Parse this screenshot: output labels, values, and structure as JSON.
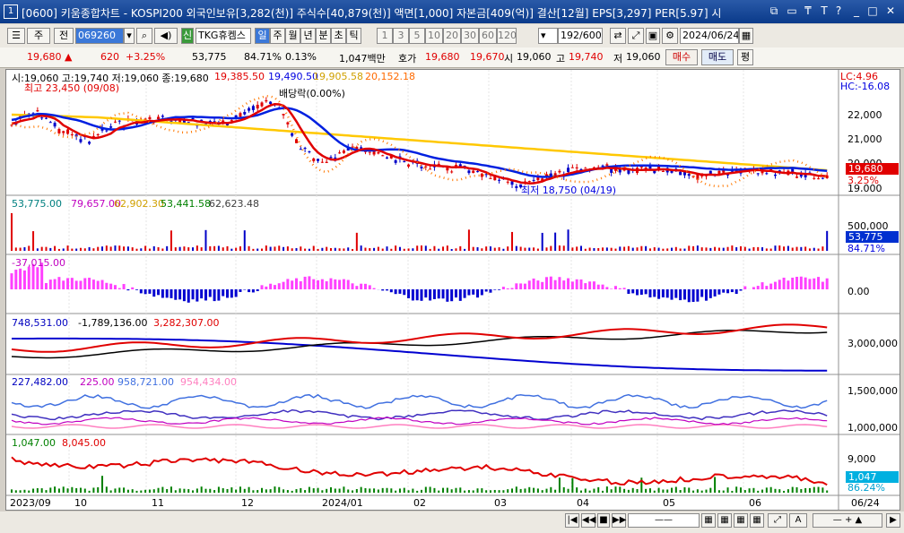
{
  "title": {
    "screen_no": "1",
    "text": "[0600] 키움종합차트 - KOSPI200 외국인보유[3,282(천)] 주식수[40,879(천)] 액면[1,000] 자본금[409(억)] 결산[12월] EPS[3,297] PER[5.97] 시"
  },
  "toolbar": {
    "type_label": "주",
    "period_label": "전",
    "code": "069260",
    "indicator_badge": "신",
    "stock_name": "TKG휴켐스",
    "tabs": [
      "일",
      "주",
      "월",
      "년",
      "분",
      "초",
      "틱"
    ],
    "active_tab": "일",
    "nums": [
      "1",
      "3",
      "5",
      "10",
      "20",
      "30",
      "60",
      "120"
    ],
    "count": "192",
    "total": "/600",
    "date": "2024/06/24"
  },
  "infobar": {
    "price": "19,680",
    "change_arrow": "▲",
    "change": "620",
    "change_pct": "+3.25%",
    "volume": "53,775",
    "vol_ratio": "84.71%",
    "turnover": "0.13%",
    "trade_value": "1,047백만",
    "quote_label": "호가",
    "ask": "19,680",
    "bid": "19,670",
    "open_label": "시",
    "open": "19,060",
    "high_label": "고",
    "high": "19,740",
    "low_label": "저",
    "low": "19,060",
    "buy_label": "매수",
    "sell_label": "매도",
    "avg_label": "평"
  },
  "panel1": {
    "ohlc": "시:19,060 고:19,740 저:19,060 종:19,680",
    "ma1": "19,385.50",
    "ma2": "19,490.50",
    "ma3": "19,905.58",
    "ma4": "20,152.18",
    "high_note": "최고 23,450 (09/08)",
    "low_note": "최저 18,750 (04/19)",
    "dividend_note": "배당락(0.00%)",
    "lc": "LC:4.96",
    "hc": "HC:-16.08",
    "price_box": "19,680",
    "pct_box": "3.25%",
    "y_ticks": [
      "22,000",
      "21,000",
      "20,000",
      "19,000"
    ]
  },
  "panel2": {
    "v1": "53,775.00",
    "v2": "79,657.00",
    "v3": "62,902.30",
    "v4": "53,441.58",
    "v5": "62,623.48",
    "tick": "500,000",
    "box1": "53,775",
    "box2": "84.71%"
  },
  "panel3": {
    "v1": "-37,015.00",
    "tick": "0.00"
  },
  "panel4": {
    "v1": "748,531.00",
    "v2": "-1,789,136.00",
    "v3": "3,282,307.00",
    "tick": "3,000,000"
  },
  "panel5": {
    "v1": "227,482.00",
    "v2": "225.00",
    "v3": "958,721.00",
    "v4": "954,434.00",
    "tick1": "1,500,000",
    "tick2": "1,000,000"
  },
  "panel6": {
    "v1": "1,047.00",
    "v2": "8,045.00",
    "tick": "9,000",
    "box1": "1,047",
    "box2": "86.24%"
  },
  "x_axis": [
    "2023/09",
    "10",
    "11",
    "12",
    "2024/01",
    "02",
    "03",
    "04",
    "05",
    "06"
  ],
  "x_right": "06/24",
  "colors": {
    "up": "#e00000",
    "down": "#0000c8",
    "ma_red": "#e00000",
    "ma_blue": "#0020e0",
    "ma_yellow": "#ffc800",
    "ma_orange": "#ff7800"
  }
}
